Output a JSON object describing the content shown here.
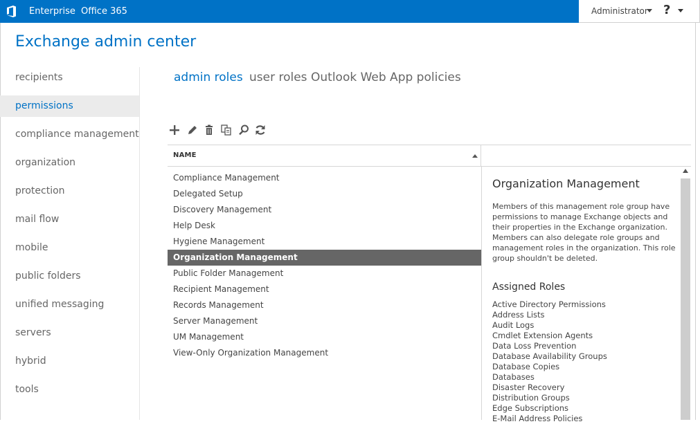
{
  "topbar": {
    "links": [
      "Enterprise",
      "Office 365"
    ],
    "user": "Administrator",
    "help": "?"
  },
  "app_title": "Exchange admin center",
  "nav": {
    "items": [
      "recipients",
      "permissions",
      "compliance management",
      "organization",
      "protection",
      "mail flow",
      "mobile",
      "public folders",
      "unified messaging",
      "servers",
      "hybrid",
      "tools"
    ],
    "selected": "permissions"
  },
  "tabs": [
    "admin roles",
    "user roles",
    "Outlook Web App policies"
  ],
  "toolbar": {
    "icons": [
      "add-icon",
      "edit-icon",
      "delete-icon",
      "copy-icon",
      "search-icon",
      "refresh-icon"
    ]
  },
  "list": {
    "column": "NAME",
    "rows": [
      "Compliance Management",
      "Delegated Setup",
      "Discovery Management",
      "Help Desk",
      "Hygiene Management",
      "Organization Management",
      "Public Folder Management",
      "Recipient Management",
      "Records Management",
      "Server Management",
      "UM Management",
      "View-Only Organization Management"
    ],
    "selected": "Organization Management"
  },
  "detail": {
    "title": "Organization Management",
    "description": "Members of this management role group have permissions to manage Exchange objects and their properties in the Exchange organization. Members can also delegate role groups and management roles in the organization. This role group shouldn't be deleted.",
    "roles_heading": "Assigned Roles",
    "roles": [
      "Active Directory Permissions",
      "Address Lists",
      "Audit Logs",
      "Cmdlet Extension Agents",
      "Data Loss Prevention",
      "Database Availability Groups",
      "Database Copies",
      "Databases",
      "Disaster Recovery",
      "Distribution Groups",
      "Edge Subscriptions",
      "E-Mail Address Policies"
    ]
  },
  "colors": {
    "brand": "#0072c6",
    "selected_row": "#666666",
    "nav_selected_bg": "#ebebeb"
  }
}
